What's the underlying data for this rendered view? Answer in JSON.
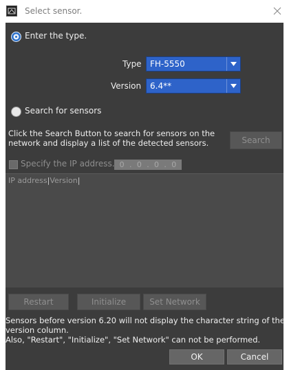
{
  "window": {
    "title": "Select sensor."
  },
  "enter_type": {
    "radio_label": "Enter the type.",
    "type_label": "Type",
    "type_value": "FH-5550",
    "version_label": "Version",
    "version_value": "6.4**"
  },
  "search": {
    "radio_label": "Search for sensors",
    "description_line1": "Click the Search Button to search for sensors on the",
    "description_line2": "network and display a list of the detected sensors.",
    "search_button": "Search",
    "specify_ip_label": "Specify the IP address.",
    "ip_octets": [
      "0",
      "0",
      "0",
      "0"
    ],
    "ip_separator": "."
  },
  "sensor_list": {
    "columns": [
      "IP address",
      "Version"
    ]
  },
  "actions": {
    "restart": "Restart",
    "initialize": "Initialize",
    "set_network": "Set Network"
  },
  "note": {
    "line1": "Sensors before version 6.20 will not display the character string of the",
    "line2": "version column.",
    "line3": "Also, \"Restart\", \"Initialize\", \"Set Network\" can not be performed."
  },
  "footer": {
    "ok": "OK",
    "cancel": "Cancel"
  },
  "colors": {
    "panel_bg": "#3c3c3c",
    "combo_blue": "#2e63c9",
    "radio_blue": "#2a6fc9"
  },
  "icons": {
    "app": "sensor-app-icon",
    "close": "close-icon",
    "dropdown": "triangle-down-icon"
  }
}
